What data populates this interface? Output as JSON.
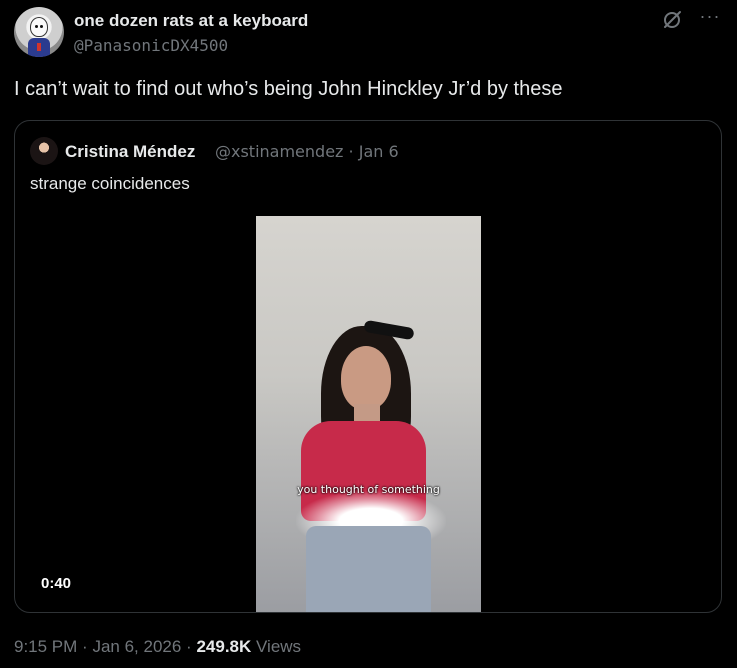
{
  "tweet": {
    "author": {
      "display_name": "one dozen rats at a keyboard",
      "handle": "@PanasonicDX4500"
    },
    "text": "I can’t wait to find out who’s being John Hinckley Jr’d by these",
    "meta": {
      "time": "9:15 PM",
      "date": "Jan 6, 2026",
      "views_count": "249.8K",
      "views_label": "Views",
      "separator": "·"
    }
  },
  "quote": {
    "author": {
      "display_name": "Cristina Méndez",
      "handle": "@xstinamendez",
      "date": "Jan 6"
    },
    "text": "strange coincidences",
    "video": {
      "caption": "you thought of something",
      "duration": "0:40"
    }
  },
  "icons": {
    "grok": "grok-icon",
    "more": "more-icon"
  },
  "colors": {
    "background": "#000000",
    "text_primary": "#e7e9ea",
    "text_secondary": "#71767b",
    "border": "#2f3336"
  }
}
